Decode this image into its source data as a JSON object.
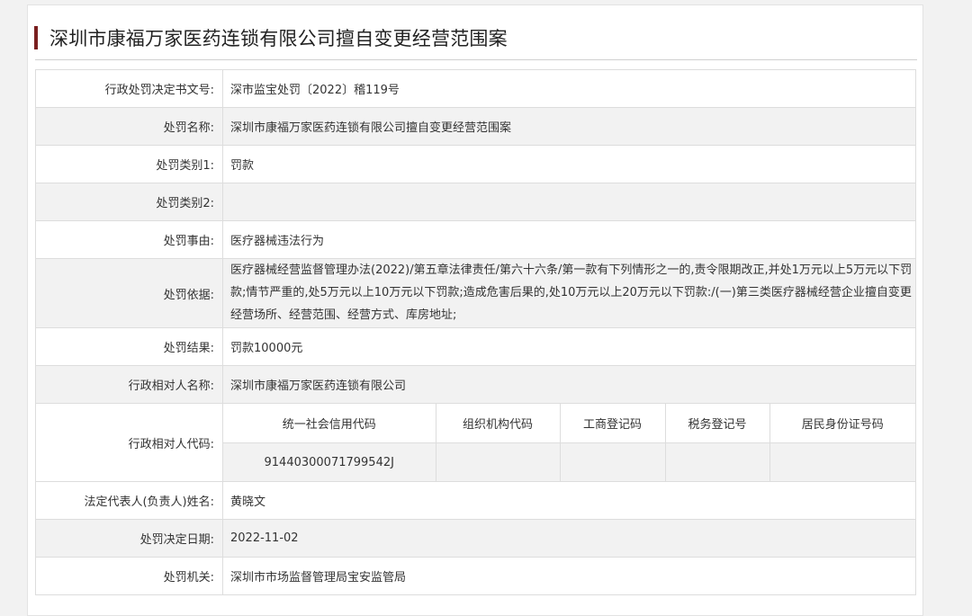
{
  "title": "深圳市康福万家医药连锁有限公司擅自变更经营范围案",
  "rows": {
    "decision_no": {
      "label": "行政处罚决定书文号:",
      "value": "深市监宝处罚〔2022〕稽119号"
    },
    "case_name": {
      "label": "处罚名称:",
      "value": "深圳市康福万家医药连锁有限公司擅自变更经营范围案"
    },
    "category1": {
      "label": "处罚类别1:",
      "value": "罚款"
    },
    "category2": {
      "label": "处罚类别2:",
      "value": ""
    },
    "reason": {
      "label": "处罚事由:",
      "value": "医疗器械违法行为"
    },
    "basis": {
      "label": "处罚依据:",
      "value": "医疗器械经营监督管理办法(2022)/第五章法律责任/第六十六条/第一款有下列情形之一的,责令限期改正,并处1万元以上5万元以下罚款;情节严重的,处5万元以上10万元以下罚款;造成危害后果的,处10万元以上20万元以下罚款:/(一)第三类医疗器械经营企业擅自变更经营场所、经营范围、经营方式、库房地址;"
    },
    "result": {
      "label": "处罚结果:",
      "value": "罚款10000元"
    },
    "party_name": {
      "label": "行政相对人名称:",
      "value": "深圳市康福万家医药连锁有限公司"
    },
    "party_code": {
      "label": "行政相对人代码:",
      "headers": [
        "统一社会信用代码",
        "组织机构代码",
        "工商登记码",
        "税务登记号",
        "居民身份证号码"
      ],
      "values": [
        "91440300071799542J",
        "",
        "",
        "",
        ""
      ]
    },
    "legal_rep": {
      "label": "法定代表人(负责人)姓名:",
      "value": "黄晓文"
    },
    "decision_date": {
      "label": "处罚决定日期:",
      "value": "2022-11-02"
    },
    "authority": {
      "label": "处罚机关:",
      "value": "深圳市市场监督管理局宝安监管局"
    }
  },
  "colors": {
    "accent_bar": "#7a1f1f",
    "alt_row": "#f2f2f2",
    "border": "#dddddd"
  }
}
